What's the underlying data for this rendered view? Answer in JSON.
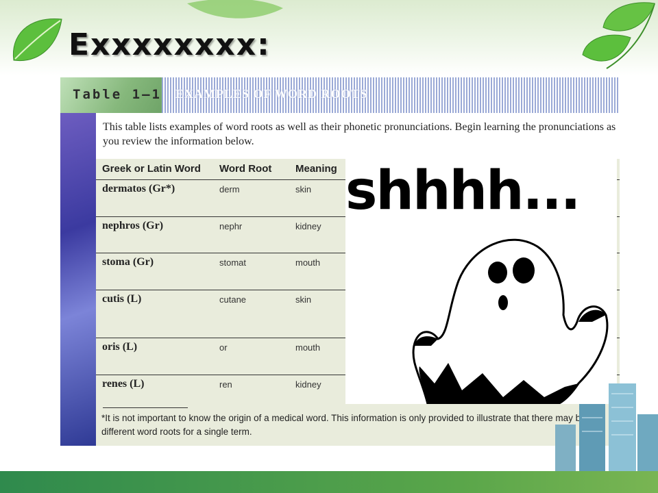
{
  "slide": {
    "title": "Exxxxxxxx:"
  },
  "table_image": {
    "label": "Table 1–1",
    "caption": "EXAMPLES OF WORD ROOTS",
    "intro": "This table lists examples of word roots as well as their phonetic pronunciations. Begin learning the pronunciations as you review the information below.",
    "columns": [
      "Greek or Latin Word",
      "Word Root",
      "Meaning"
    ],
    "rows": [
      {
        "word": "dermatos (Gr*)",
        "root": "derm",
        "meaning": "skin"
      },
      {
        "word": "nephros (Gr)",
        "root": "nephr",
        "meaning": "kidney"
      },
      {
        "word": "stoma (Gr)",
        "root": "stomat",
        "meaning": "mouth"
      },
      {
        "word": "cutis (L)",
        "root": "cutane",
        "meaning": "skin"
      },
      {
        "word": "oris (L)",
        "root": "or",
        "meaning": "mouth"
      },
      {
        "word": "renes (L)",
        "root": "ren",
        "meaning": "kidney"
      }
    ],
    "footnote": "*It is not important to know the origin of a medical word.  This information is only provided to illustrate that there may be two different word roots for a single term."
  },
  "overlay": {
    "text": "shhhh..."
  },
  "colors": {
    "leaf_green": "#4caf3a",
    "bar_green": "#2f8a4d",
    "table_bg": "#e9ecdc",
    "strip_purple": "#3b3aa0"
  }
}
